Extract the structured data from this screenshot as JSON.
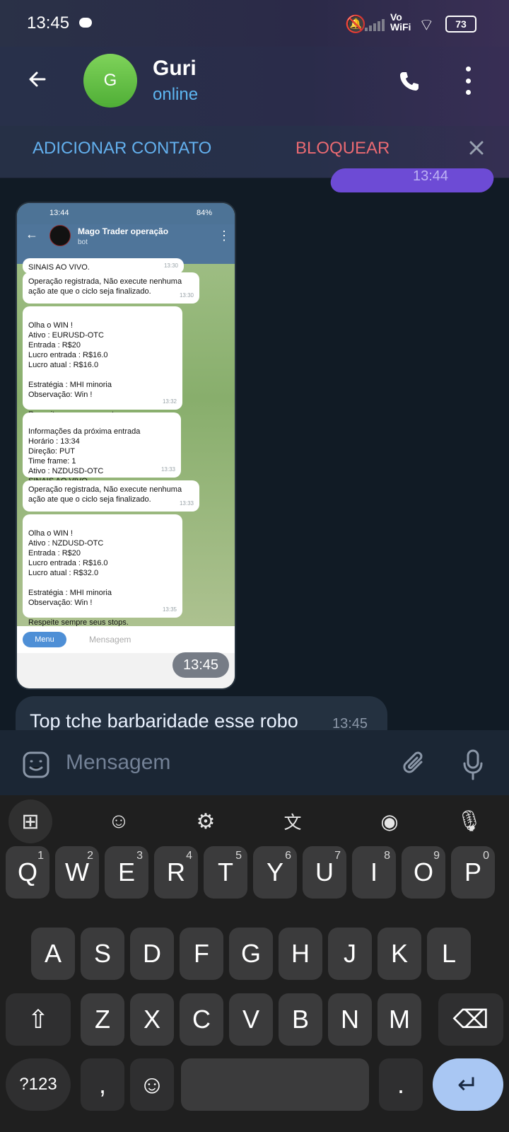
{
  "status_bar": {
    "time": "13:45",
    "network": "Vo WiFi",
    "battery": "73"
  },
  "header": {
    "avatar_letter": "G",
    "name": "Guri",
    "status": "online"
  },
  "actions": {
    "add_contact": "ADICIONAR CONTATO",
    "block": "BLOQUEAR"
  },
  "outgoing_preview": {
    "time": "13:44"
  },
  "screenshot": {
    "status_time": "13:44",
    "battery": "84%",
    "chat_title": "Mago Trader operação",
    "chat_subtitle": "bot",
    "messages": [
      {
        "text": "SINAIS AO VIVO.",
        "time": "13:30"
      },
      {
        "text": "Operação registrada, Não execute nenhuma ação ate que o ciclo seja finalizado.",
        "time": "13:30"
      },
      {
        "text": "Olha o WIN !\nAtivo : EURUSD-OTC\nEntrada : R$20\nLucro entrada : R$16.0\nLucro atual : R$16.0\n\nEstratégia : MHI minoria\nObservação: Win !\n\nRespeite sempre seus stops.",
        "time": "13:32"
      },
      {
        "text": "Informações da próxima entrada\nHorário : 13:34\nDireção: PUT\nTime frame: 1\nAtivo : NZDUSD-OTC\nSINAIS AO VIVO.",
        "time": "13:33"
      },
      {
        "text": "Operação registrada, Não execute nenhuma ação ate que o ciclo seja finalizado.",
        "time": "13:33"
      },
      {
        "text": "Olha o WIN !\nAtivo : NZDUSD-OTC\nEntrada : R$20\nLucro entrada : R$16.0\nLucro atual : R$32.0\n\nEstratégia : MHI minoria\nObservação: Win !\n\nRespeite sempre seus stops.",
        "time": "13:35"
      }
    ],
    "menu": "Menu",
    "input_placeholder": "Mensagem"
  },
  "screenshot_time": "13:45",
  "incoming": {
    "text": "Top tche barbaridade esse robo",
    "time": "13:45"
  },
  "composer": {
    "placeholder": "Mensagem"
  },
  "keyboard": {
    "row1": [
      [
        "Q",
        "1"
      ],
      [
        "W",
        "2"
      ],
      [
        "E",
        "3"
      ],
      [
        "R",
        "4"
      ],
      [
        "T",
        "5"
      ],
      [
        "Y",
        "6"
      ],
      [
        "U",
        "7"
      ],
      [
        "I",
        "8"
      ],
      [
        "O",
        "9"
      ],
      [
        "P",
        "0"
      ]
    ],
    "row2": [
      "A",
      "S",
      "D",
      "F",
      "G",
      "H",
      "J",
      "K",
      "L"
    ],
    "row3": [
      "Z",
      "X",
      "C",
      "V",
      "B",
      "N",
      "M"
    ],
    "bottom": {
      "symbols": "?123",
      "comma": ",",
      "period": "."
    }
  }
}
